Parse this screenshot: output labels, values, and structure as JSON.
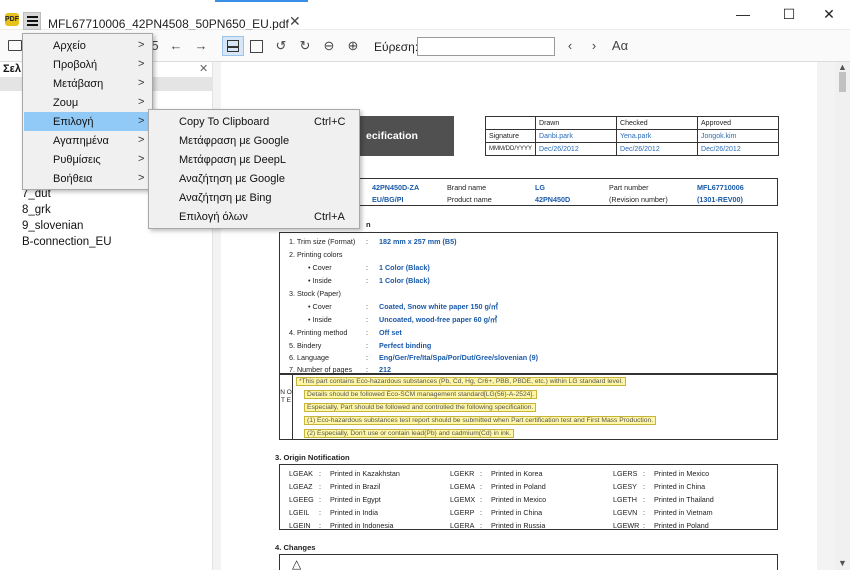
{
  "app": {
    "logo_text": "PDF",
    "tab_title": "MFL67710006_42PN4508_50PN650_EU.pdf",
    "tab_close": "✕",
    "window_controls": [
      "—",
      "☐",
      "✕"
    ]
  },
  "toolbar": {
    "page_number_fragment": "5",
    "search_label": "Εύρεση:",
    "search_value": "",
    "font_size_glyph": "Aα"
  },
  "sidebar": {
    "title": "Σελ",
    "close": "✕",
    "items": [
      "7_dut",
      "8_grk",
      "9_slovenian",
      "B-connection_EU"
    ]
  },
  "main_menu": {
    "items": [
      {
        "label": "Αρχείο",
        "arrow": ">"
      },
      {
        "label": "Προβολή",
        "arrow": ">"
      },
      {
        "label": "Μετάβαση",
        "arrow": ">"
      },
      {
        "label": "Ζουμ",
        "arrow": ">"
      },
      {
        "label": "Επιλογή",
        "arrow": ">"
      },
      {
        "label": "Αγαπημένα",
        "arrow": ">"
      },
      {
        "label": "Ρυθμίσεις",
        "arrow": ">"
      },
      {
        "label": "Βοήθεια",
        "arrow": ">"
      }
    ]
  },
  "submenu": {
    "items": [
      {
        "label": "Copy To Clipboard",
        "shortcut": "Ctrl+C"
      },
      {
        "label": "Μετάφραση με Google",
        "shortcut": ""
      },
      {
        "label": "Μετάφραση με DeepL",
        "shortcut": ""
      },
      {
        "label": "Αναζήτηση με Google",
        "shortcut": ""
      },
      {
        "label": "Αναζήτηση με Bing",
        "shortcut": ""
      },
      {
        "label": "Επιλογή όλων",
        "shortcut": "Ctrl+A"
      }
    ]
  },
  "document": {
    "title_fragment": "ecification",
    "signature": {
      "headers": [
        "Drawn",
        "Checked",
        "Approved"
      ],
      "row1_label": "Signature",
      "row1": [
        "Danbi.park",
        "Yena.park",
        "Jongok.kim"
      ],
      "row2_label": "MMM/DD/YYYY",
      "row2": [
        "Dec/26/2012",
        "Dec/26/2012",
        "Dec/26/2012"
      ]
    },
    "model": {
      "model_value_1": "42PN450D-ZA",
      "model_value_2": "EU/BG/PI",
      "brand_label": "Brand name",
      "brand_value": "LG",
      "product_label": "Product name",
      "product_value": "42PN450D",
      "part_label": "Part number",
      "part_value": "MFL67710006",
      "revision_label": "(Revision number)",
      "revision_value": "(1301-REV00)"
    },
    "spec_section_fragment": "n",
    "specs": {
      "trim_label": "1. Trim size (Format)",
      "trim_value": "182 mm x 257 mm (B5)",
      "colors_label": "2. Printing colors",
      "cover_label": "• Cover",
      "cover_value": "1 Color (Black)",
      "inside_label": "• Inside",
      "inside_value": "1 Color (Black)",
      "stock_label": "3. Stock (Paper)",
      "stock_cover_value": "Coated, Snow white paper 150 g/㎡",
      "stock_inside_value": "Uncoated, wood-free paper 60 g/㎡",
      "method_label": "4. Printing method",
      "method_value": "Off set",
      "bindery_label": "5. Bindery",
      "bindery_value": "Perfect binding",
      "language_label": "6. Language",
      "language_value": "Eng/Ger/Fre/Ita/Spa/Por/Dut/Gree/slovenian (9)",
      "pages_label": "7. Number of pages",
      "pages_value": "212",
      "colon": ":"
    },
    "note": {
      "side_label": "N O T E",
      "lines": [
        "*This part contains Eco-hazardous substances (Pb, Cd, Hg, Cr6+, PBB, PBDE, etc.) within LG standard level.",
        "Details should be followed Eco-SCM management standard[LG(56)-A-2524].",
        "Especially, Part should be followed and controlled the following specification.",
        "(1) Eco-hazardous substances test report should be submitted when Part certification test and First Mass Production.",
        "(2) Especially, Don't use or contain lead(Pb) and cadmium(Cd) in ink."
      ]
    },
    "origin": {
      "heading": "3. Origin Notification",
      "rows": [
        [
          [
            "LGEAK",
            "Printed in Kazakhstan"
          ],
          [
            "LGEKR",
            "Printed in Korea"
          ],
          [
            "LGERS",
            "Printed in Mexico"
          ]
        ],
        [
          [
            "LGEAZ",
            "Printed in Brazil"
          ],
          [
            "LGEMA",
            "Printed in Poland"
          ],
          [
            "LGESY",
            "Printed in China"
          ]
        ],
        [
          [
            "LGEEG",
            "Printed in Egypt"
          ],
          [
            "LGEMX",
            "Printed in Mexico"
          ],
          [
            "LGETH",
            "Printed in Thailand"
          ]
        ],
        [
          [
            "LGEIL",
            "Printed in India"
          ],
          [
            "LGERP",
            "Printed in China"
          ],
          [
            "LGEVN",
            "Printed in Vietnam"
          ]
        ],
        [
          [
            "LGEIN",
            "Printed in Indonesia"
          ],
          [
            "LGERA",
            "Printed in Russia"
          ],
          [
            "LGEWR",
            "Printed in Poland"
          ]
        ]
      ]
    },
    "changes_heading": "4. Changes"
  }
}
